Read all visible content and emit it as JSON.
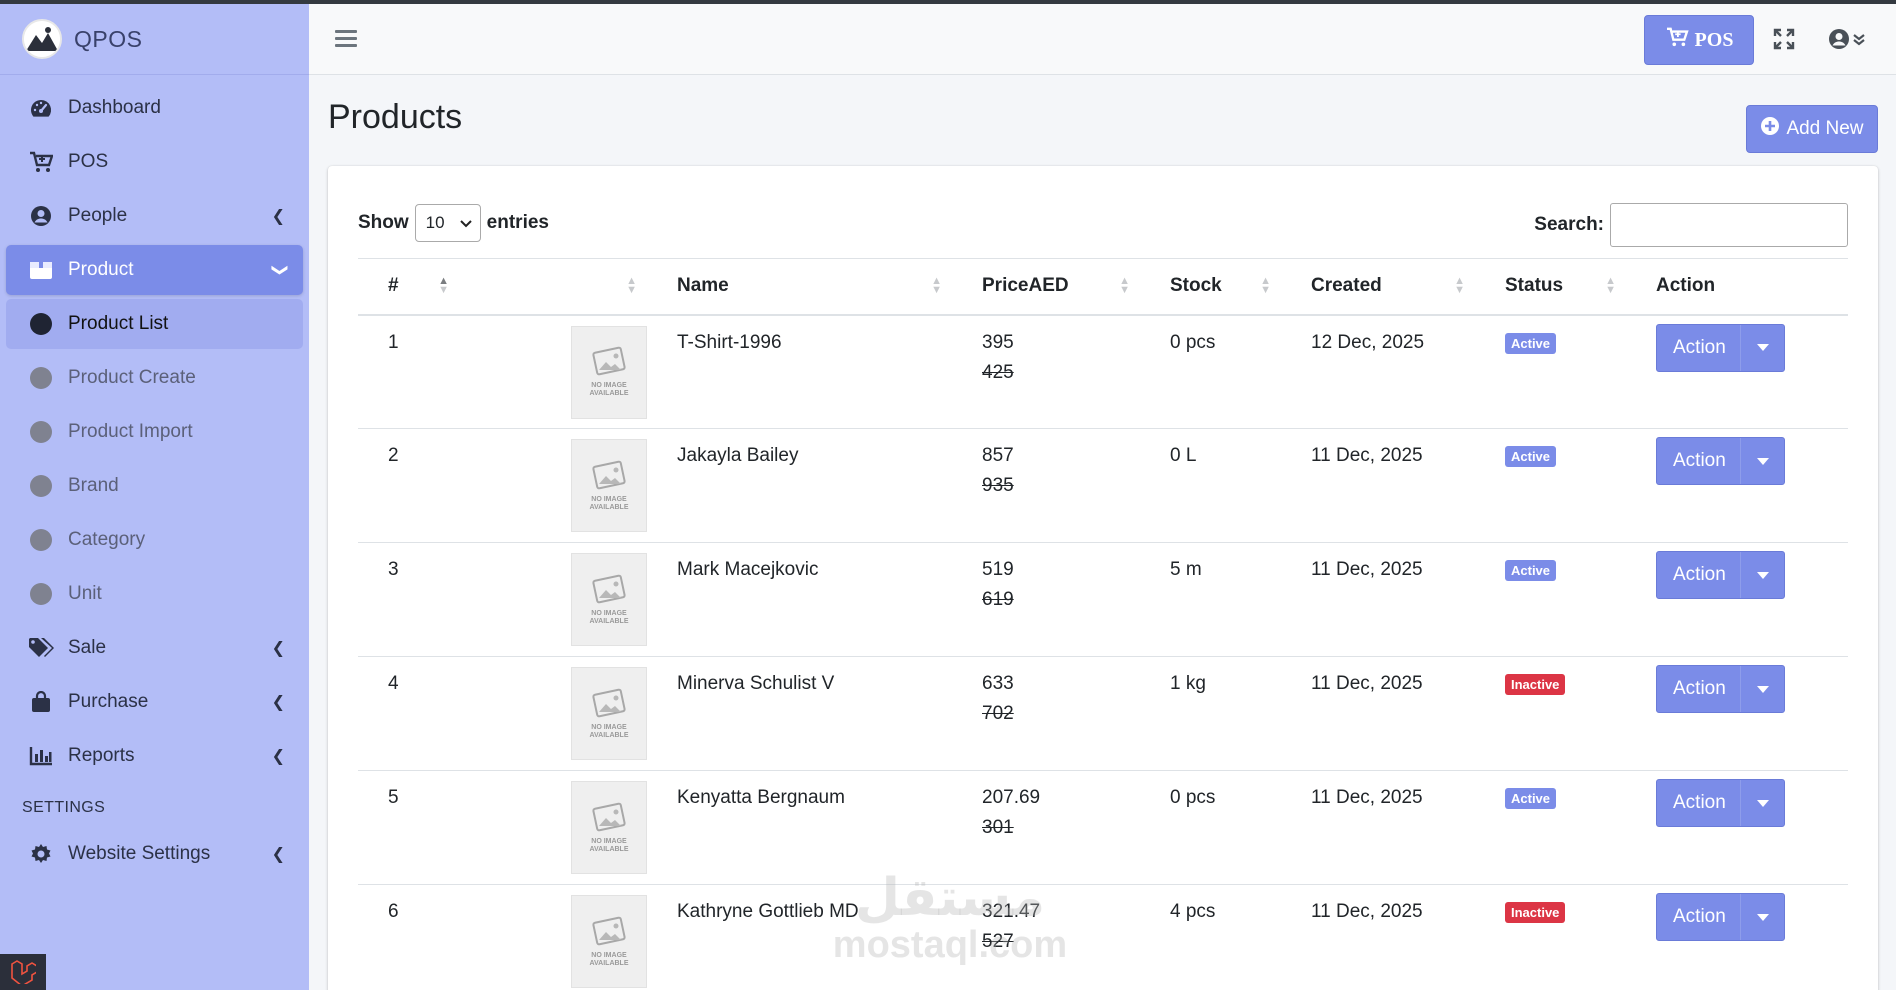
{
  "app": {
    "brand": "QPOS"
  },
  "sidebar": {
    "items": [
      {
        "label": "Dashboard",
        "icon": "dashboard-icon"
      },
      {
        "label": "POS",
        "icon": "cart-icon"
      },
      {
        "label": "People",
        "icon": "user-circle-icon",
        "chevron": true
      },
      {
        "label": "Product",
        "icon": "box-icon",
        "chevron": true,
        "expanded": true
      },
      {
        "label": "Product List",
        "sub": true,
        "active": true
      },
      {
        "label": "Product Create",
        "sub": true
      },
      {
        "label": "Product Import",
        "sub": true
      },
      {
        "label": "Brand",
        "sub": true
      },
      {
        "label": "Category",
        "sub": true
      },
      {
        "label": "Unit",
        "sub": true
      },
      {
        "label": "Sale",
        "icon": "tags-icon",
        "chevron": true
      },
      {
        "label": "Purchase",
        "icon": "bag-icon",
        "chevron": true
      },
      {
        "label": "Reports",
        "icon": "chart-icon",
        "chevron": true
      }
    ],
    "settings_header": "SETTINGS",
    "settings_items": [
      {
        "label": "Website Settings",
        "icon": "gear-icon",
        "chevron": true
      }
    ]
  },
  "navbar": {
    "pos_label": "POS"
  },
  "page": {
    "title": "Products",
    "add_label": "Add New"
  },
  "table_controls": {
    "show_label": "Show",
    "entries_value": "10",
    "entries_label": "entries",
    "search_label": "Search:"
  },
  "table": {
    "headers": [
      "#",
      "",
      "Name",
      "PriceAED",
      "Stock",
      "Created",
      "Status",
      "Action"
    ],
    "rows": [
      {
        "num": "1",
        "name": "T-Shirt-1996",
        "price": "395",
        "old_price": "425",
        "stock": "0 pcs",
        "created": "12 Dec, 2025",
        "status": "Active",
        "action": "Action"
      },
      {
        "num": "2",
        "name": "Jakayla Bailey",
        "price": "857",
        "old_price": "935",
        "stock": "0 L",
        "created": "11 Dec, 2025",
        "status": "Active",
        "action": "Action"
      },
      {
        "num": "3",
        "name": "Mark Macejkovic",
        "price": "519",
        "old_price": "619",
        "stock": "5 m",
        "created": "11 Dec, 2025",
        "status": "Active",
        "action": "Action"
      },
      {
        "num": "4",
        "name": "Minerva Schulist V",
        "price": "633",
        "old_price": "702",
        "stock": "1 kg",
        "created": "11 Dec, 2025",
        "status": "Inactive",
        "action": "Action"
      },
      {
        "num": "5",
        "name": "Kenyatta Bergnaum",
        "price": "207.69",
        "old_price": "301",
        "stock": "0 pcs",
        "created": "11 Dec, 2025",
        "status": "Active",
        "action": "Action"
      },
      {
        "num": "6",
        "name": "Kathryne Gottlieb MD",
        "price": "321.47",
        "old_price": "527",
        "stock": "4 pcs",
        "created": "11 Dec, 2025",
        "status": "Inactive",
        "action": "Action"
      }
    ],
    "no_image_text": "NO IMAGE AVAILABLE"
  },
  "watermark": {
    "arabic": "مستقل",
    "latin": "mostaql.com"
  },
  "colors": {
    "accent": "#7b8ce8",
    "sidebar_bg": "#b3bdf7",
    "danger": "#dc3545"
  }
}
